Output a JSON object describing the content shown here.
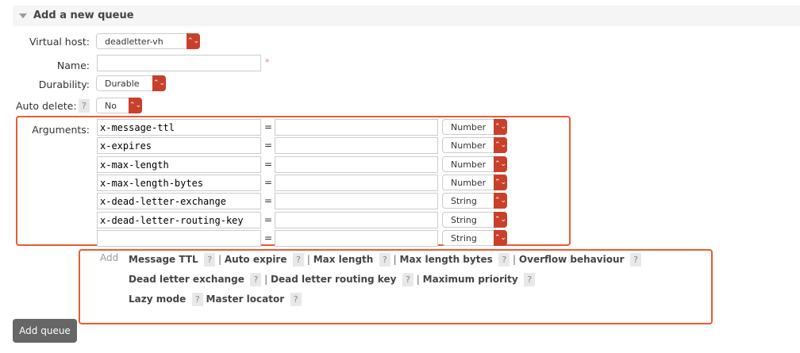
{
  "section": {
    "title": "Add a new queue"
  },
  "form": {
    "virtual_host": {
      "label": "Virtual host:",
      "value": "deadletter-vh"
    },
    "name": {
      "label": "Name:",
      "value": "",
      "required_mark": "*"
    },
    "durability": {
      "label": "Durability:",
      "value": "Durable"
    },
    "auto_delete": {
      "label": "Auto delete:",
      "help": "?",
      "value": "No"
    },
    "arguments_label": "Arguments:",
    "arguments": [
      {
        "key": "x-message-ttl",
        "value": "",
        "type": "Number"
      },
      {
        "key": "x-expires",
        "value": "",
        "type": "Number"
      },
      {
        "key": "x-max-length",
        "value": "",
        "type": "Number"
      },
      {
        "key": "x-max-length-bytes",
        "value": "",
        "type": "Number"
      },
      {
        "key": "x-dead-letter-exchange",
        "value": "",
        "type": "String"
      },
      {
        "key": "x-dead-letter-routing-key",
        "value": "",
        "type": "String"
      },
      {
        "key": "",
        "value": "",
        "type": "String"
      }
    ],
    "equals": "=",
    "add_label": "Add",
    "help": "?",
    "sep": "|",
    "shortcuts": [
      "Message TTL",
      "Auto expire",
      "Max length",
      "Max length bytes",
      "Overflow behaviour",
      "Dead letter exchange",
      "Dead letter routing key",
      "Maximum priority",
      "Lazy mode",
      "Master locator"
    ]
  },
  "submit_label": "Add queue",
  "icons": {
    "collapse": "triangle-down-icon",
    "select": "up-down-chevron-icon"
  }
}
